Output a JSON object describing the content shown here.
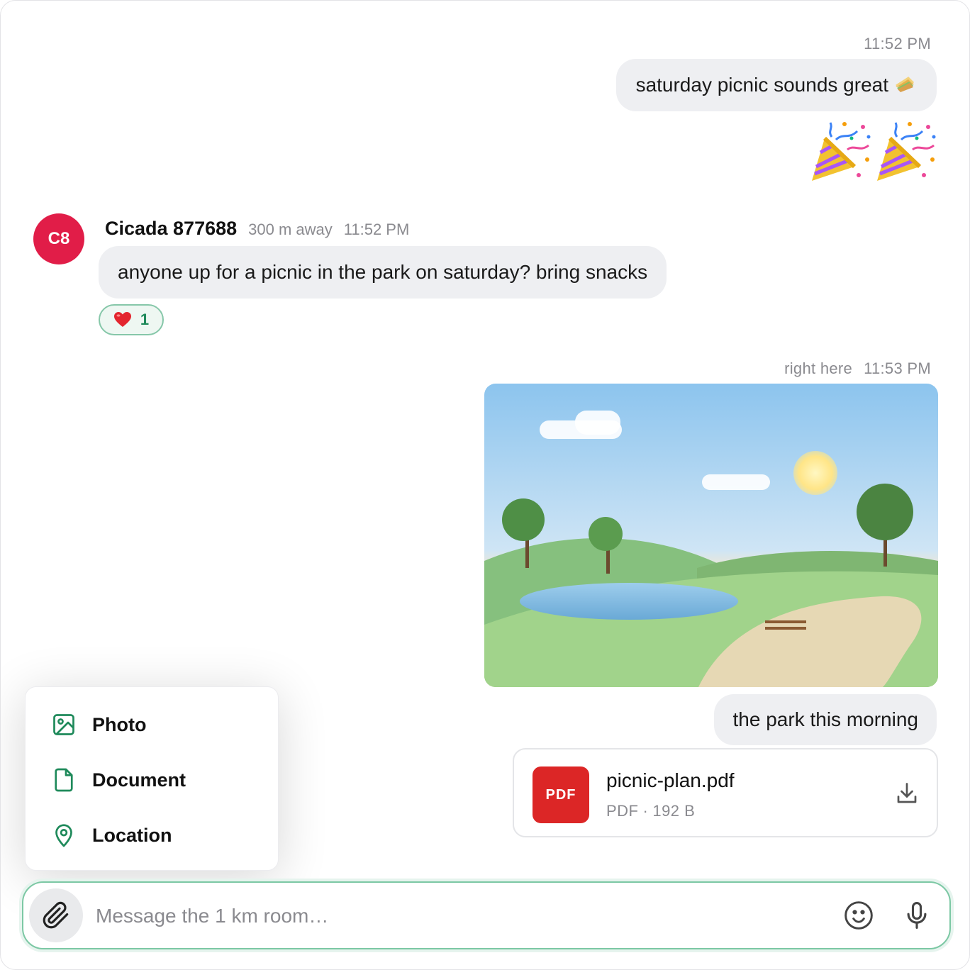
{
  "messages": {
    "mine_1": {
      "time": "11:52 PM",
      "text": "saturday picnic sounds great",
      "emoji": "sandwich-icon",
      "sticker": "party-popper-icon"
    },
    "other_1": {
      "avatar_initials": "C8",
      "sender": "Cicada 877688",
      "distance": "300 m away",
      "time": "11:52 PM",
      "text": "anyone up for a picnic in the park on saturday? bring snacks",
      "reaction": {
        "icon": "heart-icon",
        "count": "1"
      }
    },
    "mine_2": {
      "distance": "right here",
      "time": "11:53 PM",
      "image": "park-landscape",
      "text": "the park this morning",
      "file": {
        "badge": "PDF",
        "name": "picnic-plan.pdf",
        "type": "PDF",
        "separator": "·",
        "size": "192 B"
      }
    }
  },
  "attach_menu": {
    "items": [
      {
        "label": "Photo",
        "icon": "image-icon"
      },
      {
        "label": "Document",
        "icon": "document-icon"
      },
      {
        "label": "Location",
        "icon": "map-pin-icon"
      }
    ]
  },
  "composer": {
    "placeholder": "Message the 1 km room…"
  },
  "colors": {
    "accent": "#1f8a5b",
    "avatar": "#e11d48",
    "pdf": "#dc2626",
    "bubble": "#eeeff2"
  }
}
